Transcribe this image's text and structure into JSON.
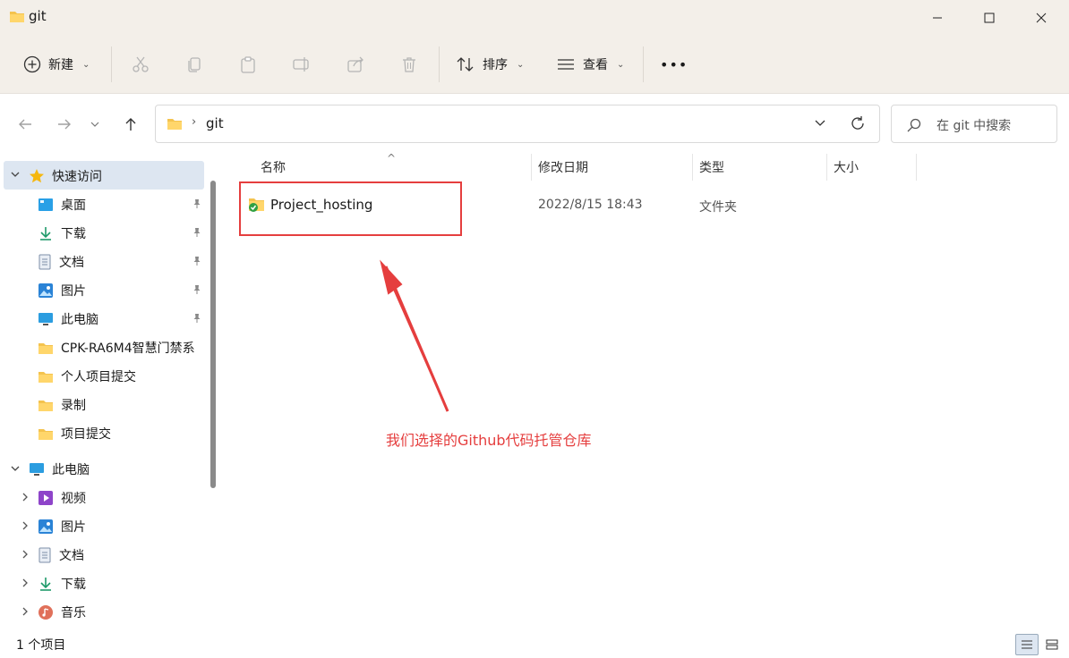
{
  "window": {
    "title": "git"
  },
  "toolbar": {
    "new_label": "新建",
    "sort_label": "排序",
    "view_label": "查看",
    "more_label": "•••"
  },
  "address": {
    "path": "git",
    "separator": "›"
  },
  "search": {
    "placeholder": "在 git 中搜索"
  },
  "sidebar": {
    "quick_access": "快速访问",
    "quick_items": [
      {
        "label": "桌面",
        "icon": "desktop-icon"
      },
      {
        "label": "下载",
        "icon": "download-icon"
      },
      {
        "label": "文档",
        "icon": "document-icon"
      },
      {
        "label": "图片",
        "icon": "picture-icon"
      },
      {
        "label": "此电脑",
        "icon": "monitor-icon"
      },
      {
        "label": "CPK-RA6M4智慧门禁系",
        "icon": "folder-icon"
      },
      {
        "label": "个人项目提交",
        "icon": "folder-icon"
      },
      {
        "label": "录制",
        "icon": "folder-icon"
      },
      {
        "label": "项目提交",
        "icon": "folder-icon"
      }
    ],
    "this_pc": "此电脑",
    "pc_items": [
      {
        "label": "视频",
        "icon": "video-icon"
      },
      {
        "label": "图片",
        "icon": "picture-icon"
      },
      {
        "label": "文档",
        "icon": "document-icon"
      },
      {
        "label": "下载",
        "icon": "download-icon"
      },
      {
        "label": "音乐",
        "icon": "music-icon"
      }
    ]
  },
  "columns": {
    "name": "名称",
    "modified": "修改日期",
    "type": "类型",
    "size": "大小"
  },
  "files": [
    {
      "name": "Project_hosting",
      "modified": "2022/8/15 18:43",
      "type": "文件夹"
    }
  ],
  "annotation": {
    "text": "我们选择的Github代码托管仓库",
    "color": "#e53e3e"
  },
  "status": {
    "item_count": "1 个项目"
  },
  "colors": {
    "accent": "#0067c0",
    "folder": "#f4c34e",
    "highlight": "#e53e3e"
  }
}
